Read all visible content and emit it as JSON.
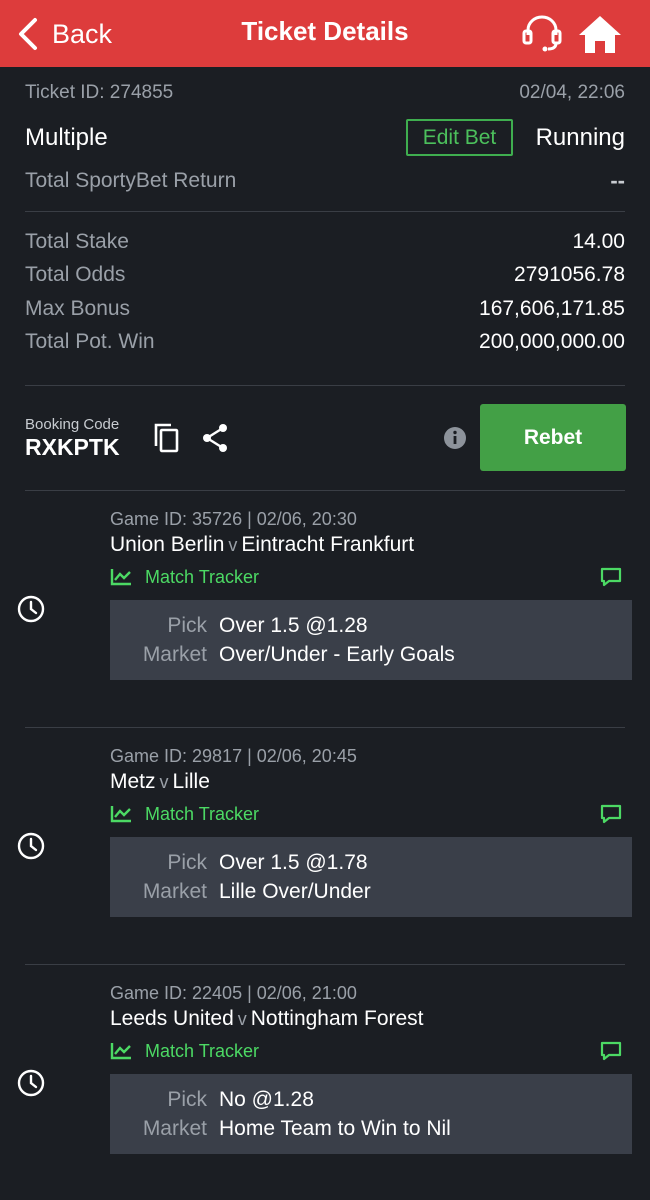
{
  "header": {
    "back_label": "Back",
    "title": "Ticket Details"
  },
  "ticket": {
    "id_label": "Ticket ID: 274855",
    "datetime": "02/04, 22:06",
    "type": "Multiple",
    "edit_label": "Edit Bet",
    "status": "Running",
    "return_label": "Total SportyBet Return",
    "return_value": "--"
  },
  "stats": [
    {
      "label": "Total Stake",
      "value": "14.00"
    },
    {
      "label": "Total Odds",
      "value": "2791056.78"
    },
    {
      "label": "Max Bonus",
      "value": "167,606,171.85"
    },
    {
      "label": "Total Pot. Win",
      "value": "200,000,000.00"
    }
  ],
  "booking": {
    "label": "Booking Code",
    "code": "RXKPTK",
    "rebet_label": "Rebet"
  },
  "games": [
    {
      "game_info": "Game ID: 35726 | 02/06, 20:30",
      "home": "Union Berlin",
      "vs": "v",
      "away": "Eintracht Frankfurt",
      "tracker_label": "Match Tracker",
      "pick_key": "Pick",
      "pick": "Over 1.5 @1.28",
      "market_key": "Market",
      "market": "Over/Under - Early Goals"
    },
    {
      "game_info": "Game ID: 29817 | 02/06, 20:45",
      "home": "Metz",
      "vs": "v",
      "away": "Lille",
      "tracker_label": "Match Tracker",
      "pick_key": "Pick",
      "pick": "Over 1.5 @1.78",
      "market_key": "Market",
      "market": "Lille Over/Under"
    },
    {
      "game_info": "Game ID: 22405 | 02/06, 21:00",
      "home": "Leeds United",
      "vs": "v",
      "away": "Nottingham Forest",
      "tracker_label": "Match Tracker",
      "pick_key": "Pick",
      "pick": "No @1.28",
      "market_key": "Market",
      "market": "Home Team to Win to Nil"
    }
  ],
  "colors": {
    "header": "#dd3c3c",
    "background": "#1b1e23",
    "accent_green": "#43a046",
    "tracker_green": "#4cd964"
  }
}
